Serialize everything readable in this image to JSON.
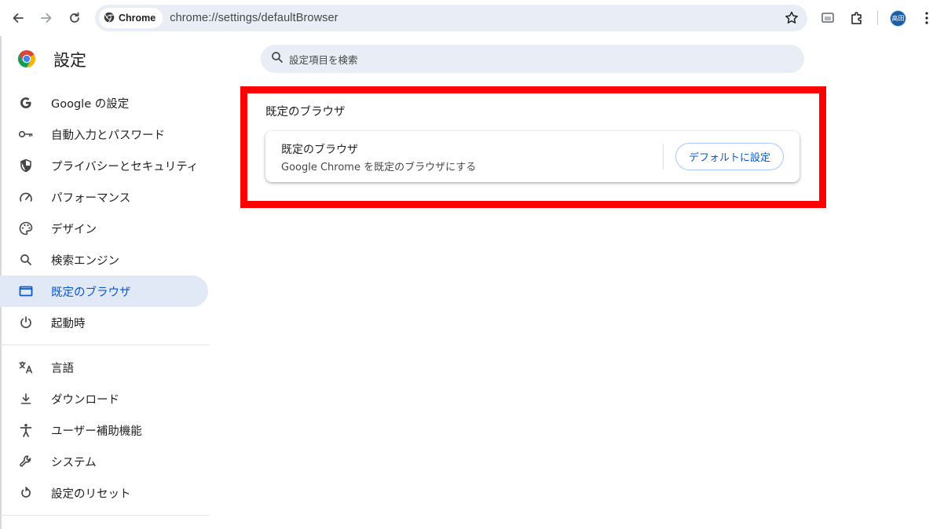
{
  "toolbar": {
    "chip_label": "Chrome",
    "url": "chrome://settings/defaultBrowser",
    "avatar_text": "高田",
    "icons": [
      "back-icon",
      "forward-icon",
      "reload-icon",
      "chrome-logo-icon",
      "star-icon",
      "cast-icon",
      "extensions-icon",
      "avatar",
      "more-icon"
    ]
  },
  "header": {
    "title": "設定",
    "search_placeholder": "設定項目を検索"
  },
  "sidebar": {
    "items": [
      {
        "label": "Google の設定",
        "icon": "google-g-icon"
      },
      {
        "label": "自動入力とパスワード",
        "icon": "key-icon"
      },
      {
        "label": "プライバシーとセキュリティ",
        "icon": "shield-icon"
      },
      {
        "label": "パフォーマンス",
        "icon": "speedometer-icon"
      },
      {
        "label": "デザイン",
        "icon": "palette-icon"
      },
      {
        "label": "検索エンジン",
        "icon": "search-icon"
      },
      {
        "label": "既定のブラウザ",
        "icon": "browser-window-icon",
        "active": true
      },
      {
        "label": "起動時",
        "icon": "power-icon"
      }
    ],
    "items2": [
      {
        "label": "言語",
        "icon": "translate-icon"
      },
      {
        "label": "ダウンロード",
        "icon": "download-icon"
      },
      {
        "label": "ユーザー補助機能",
        "icon": "accessibility-icon"
      },
      {
        "label": "システム",
        "icon": "wrench-icon"
      },
      {
        "label": "設定のリセット",
        "icon": "reset-icon"
      }
    ]
  },
  "main": {
    "section_title": "既定のブラウザ",
    "card": {
      "title": "既定のブラウザ",
      "subtitle": "Google Chrome を既定のブラウザにする",
      "button_label": "デフォルトに設定"
    }
  },
  "colors": {
    "accent": "#0b57d0",
    "highlight_border": "#ff0000",
    "active_bg": "#e1e9f6",
    "omnibox_bg": "#e9eef6"
  }
}
